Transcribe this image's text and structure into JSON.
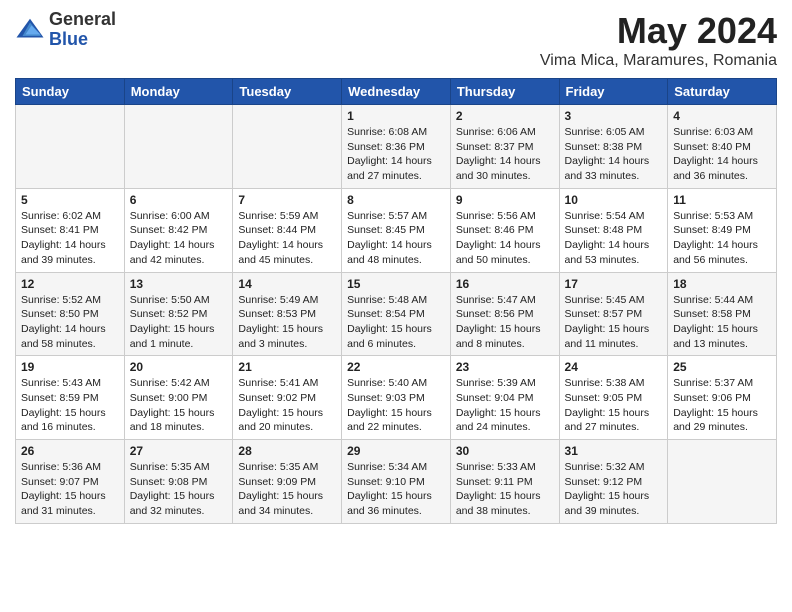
{
  "header": {
    "logo_general": "General",
    "logo_blue": "Blue",
    "month_title": "May 2024",
    "location": "Vima Mica, Maramures, Romania"
  },
  "weekdays": [
    "Sunday",
    "Monday",
    "Tuesday",
    "Wednesday",
    "Thursday",
    "Friday",
    "Saturday"
  ],
  "weeks": [
    [
      {
        "day": "",
        "info": ""
      },
      {
        "day": "",
        "info": ""
      },
      {
        "day": "",
        "info": ""
      },
      {
        "day": "1",
        "info": "Sunrise: 6:08 AM\nSunset: 8:36 PM\nDaylight: 14 hours\nand 27 minutes."
      },
      {
        "day": "2",
        "info": "Sunrise: 6:06 AM\nSunset: 8:37 PM\nDaylight: 14 hours\nand 30 minutes."
      },
      {
        "day": "3",
        "info": "Sunrise: 6:05 AM\nSunset: 8:38 PM\nDaylight: 14 hours\nand 33 minutes."
      },
      {
        "day": "4",
        "info": "Sunrise: 6:03 AM\nSunset: 8:40 PM\nDaylight: 14 hours\nand 36 minutes."
      }
    ],
    [
      {
        "day": "5",
        "info": "Sunrise: 6:02 AM\nSunset: 8:41 PM\nDaylight: 14 hours\nand 39 minutes."
      },
      {
        "day": "6",
        "info": "Sunrise: 6:00 AM\nSunset: 8:42 PM\nDaylight: 14 hours\nand 42 minutes."
      },
      {
        "day": "7",
        "info": "Sunrise: 5:59 AM\nSunset: 8:44 PM\nDaylight: 14 hours\nand 45 minutes."
      },
      {
        "day": "8",
        "info": "Sunrise: 5:57 AM\nSunset: 8:45 PM\nDaylight: 14 hours\nand 48 minutes."
      },
      {
        "day": "9",
        "info": "Sunrise: 5:56 AM\nSunset: 8:46 PM\nDaylight: 14 hours\nand 50 minutes."
      },
      {
        "day": "10",
        "info": "Sunrise: 5:54 AM\nSunset: 8:48 PM\nDaylight: 14 hours\nand 53 minutes."
      },
      {
        "day": "11",
        "info": "Sunrise: 5:53 AM\nSunset: 8:49 PM\nDaylight: 14 hours\nand 56 minutes."
      }
    ],
    [
      {
        "day": "12",
        "info": "Sunrise: 5:52 AM\nSunset: 8:50 PM\nDaylight: 14 hours\nand 58 minutes."
      },
      {
        "day": "13",
        "info": "Sunrise: 5:50 AM\nSunset: 8:52 PM\nDaylight: 15 hours\nand 1 minute."
      },
      {
        "day": "14",
        "info": "Sunrise: 5:49 AM\nSunset: 8:53 PM\nDaylight: 15 hours\nand 3 minutes."
      },
      {
        "day": "15",
        "info": "Sunrise: 5:48 AM\nSunset: 8:54 PM\nDaylight: 15 hours\nand 6 minutes."
      },
      {
        "day": "16",
        "info": "Sunrise: 5:47 AM\nSunset: 8:56 PM\nDaylight: 15 hours\nand 8 minutes."
      },
      {
        "day": "17",
        "info": "Sunrise: 5:45 AM\nSunset: 8:57 PM\nDaylight: 15 hours\nand 11 minutes."
      },
      {
        "day": "18",
        "info": "Sunrise: 5:44 AM\nSunset: 8:58 PM\nDaylight: 15 hours\nand 13 minutes."
      }
    ],
    [
      {
        "day": "19",
        "info": "Sunrise: 5:43 AM\nSunset: 8:59 PM\nDaylight: 15 hours\nand 16 minutes."
      },
      {
        "day": "20",
        "info": "Sunrise: 5:42 AM\nSunset: 9:00 PM\nDaylight: 15 hours\nand 18 minutes."
      },
      {
        "day": "21",
        "info": "Sunrise: 5:41 AM\nSunset: 9:02 PM\nDaylight: 15 hours\nand 20 minutes."
      },
      {
        "day": "22",
        "info": "Sunrise: 5:40 AM\nSunset: 9:03 PM\nDaylight: 15 hours\nand 22 minutes."
      },
      {
        "day": "23",
        "info": "Sunrise: 5:39 AM\nSunset: 9:04 PM\nDaylight: 15 hours\nand 24 minutes."
      },
      {
        "day": "24",
        "info": "Sunrise: 5:38 AM\nSunset: 9:05 PM\nDaylight: 15 hours\nand 27 minutes."
      },
      {
        "day": "25",
        "info": "Sunrise: 5:37 AM\nSunset: 9:06 PM\nDaylight: 15 hours\nand 29 minutes."
      }
    ],
    [
      {
        "day": "26",
        "info": "Sunrise: 5:36 AM\nSunset: 9:07 PM\nDaylight: 15 hours\nand 31 minutes."
      },
      {
        "day": "27",
        "info": "Sunrise: 5:35 AM\nSunset: 9:08 PM\nDaylight: 15 hours\nand 32 minutes."
      },
      {
        "day": "28",
        "info": "Sunrise: 5:35 AM\nSunset: 9:09 PM\nDaylight: 15 hours\nand 34 minutes."
      },
      {
        "day": "29",
        "info": "Sunrise: 5:34 AM\nSunset: 9:10 PM\nDaylight: 15 hours\nand 36 minutes."
      },
      {
        "day": "30",
        "info": "Sunrise: 5:33 AM\nSunset: 9:11 PM\nDaylight: 15 hours\nand 38 minutes."
      },
      {
        "day": "31",
        "info": "Sunrise: 5:32 AM\nSunset: 9:12 PM\nDaylight: 15 hours\nand 39 minutes."
      },
      {
        "day": "",
        "info": ""
      }
    ]
  ]
}
